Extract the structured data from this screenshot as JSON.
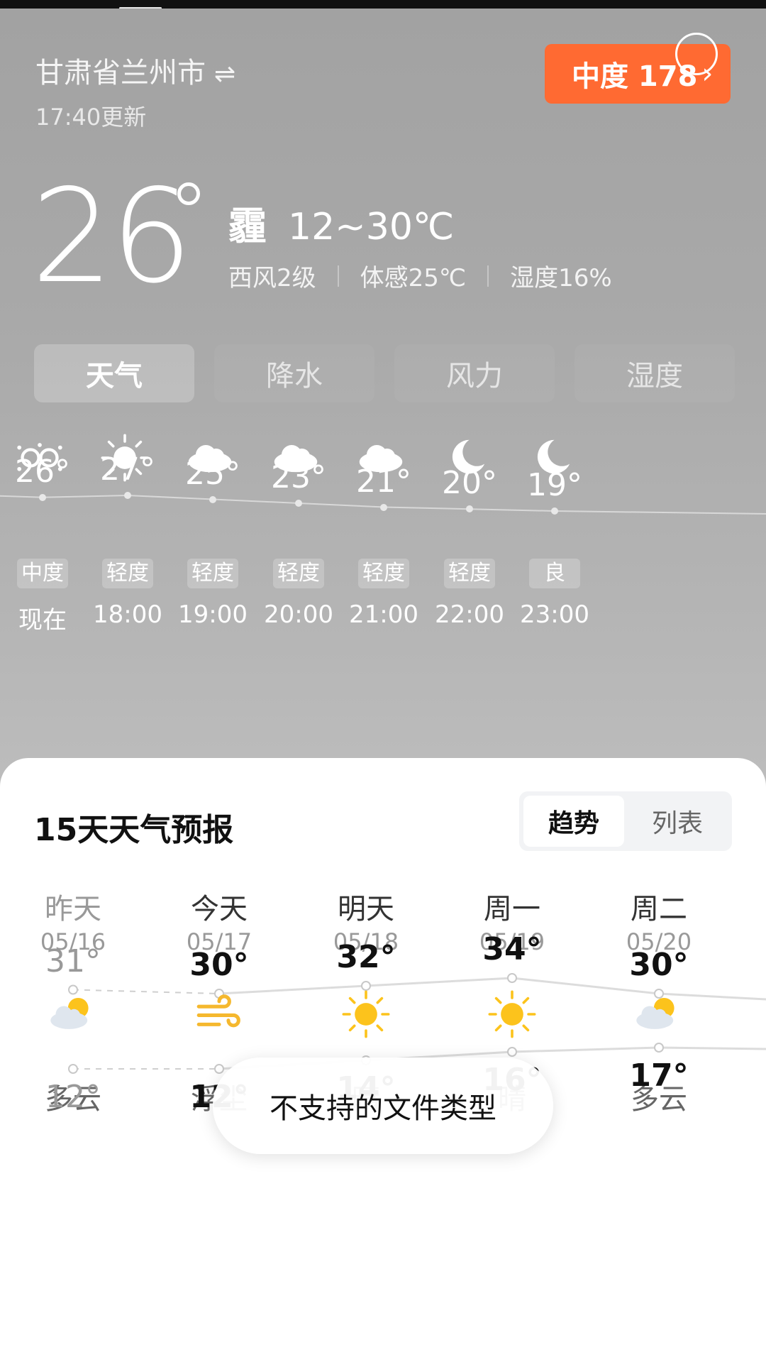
{
  "header": {
    "city": "甘肃省兰州市",
    "swap_icon": "⇌",
    "updated": "17:40更新",
    "aqi_button": "中度 178",
    "aqi_chevron": "›"
  },
  "current": {
    "temperature": "26",
    "condition": "霾",
    "range": "12~30℃",
    "wind": "西风2级",
    "feels_like": "体感25℃",
    "humidity": "湿度16%"
  },
  "tabs": [
    "天气",
    "降水",
    "风力",
    "湿度"
  ],
  "hourly": [
    {
      "icon": "haze-icon",
      "temp": "26°",
      "aqi": "中度",
      "time": "现在"
    },
    {
      "icon": "sun-icon",
      "temp": "27°",
      "aqi": "轻度",
      "time": "18:00"
    },
    {
      "icon": "cloud-icon",
      "temp": "25°",
      "aqi": "轻度",
      "time": "19:00"
    },
    {
      "icon": "cloud-icon",
      "temp": "23°",
      "aqi": "轻度",
      "time": "20:00"
    },
    {
      "icon": "cloud-icon",
      "temp": "21°",
      "aqi": "轻度",
      "time": "21:00"
    },
    {
      "icon": "moon-icon",
      "temp": "20°",
      "aqi": "轻度",
      "time": "22:00"
    },
    {
      "icon": "moon-icon",
      "temp": "19°",
      "aqi": "良",
      "time": "23:00"
    }
  ],
  "forecast": {
    "title": "15天天气预报",
    "toggle_trend": "趋势",
    "toggle_list": "列表",
    "days": [
      {
        "name": "昨天",
        "date": "05/16",
        "icon": "partly-cloudy-icon",
        "cond": "多云",
        "high": "31°",
        "low": "12°"
      },
      {
        "name": "今天",
        "date": "05/17",
        "icon": "wind-dust-icon",
        "cond": "浮尘",
        "high": "30°",
        "low": "12°"
      },
      {
        "name": "明天",
        "date": "05/18",
        "icon": "sun-icon",
        "cond": "晴",
        "high": "32°",
        "low": "14°"
      },
      {
        "name": "周一",
        "date": "05/19",
        "icon": "sun-icon",
        "cond": "晴",
        "high": "34°",
        "low": "16°"
      },
      {
        "name": "周二",
        "date": "05/20",
        "icon": "partly-cloudy-icon",
        "cond": "多云",
        "high": "30°",
        "low": "17°"
      }
    ]
  },
  "toast": "不支持的文件类型"
}
